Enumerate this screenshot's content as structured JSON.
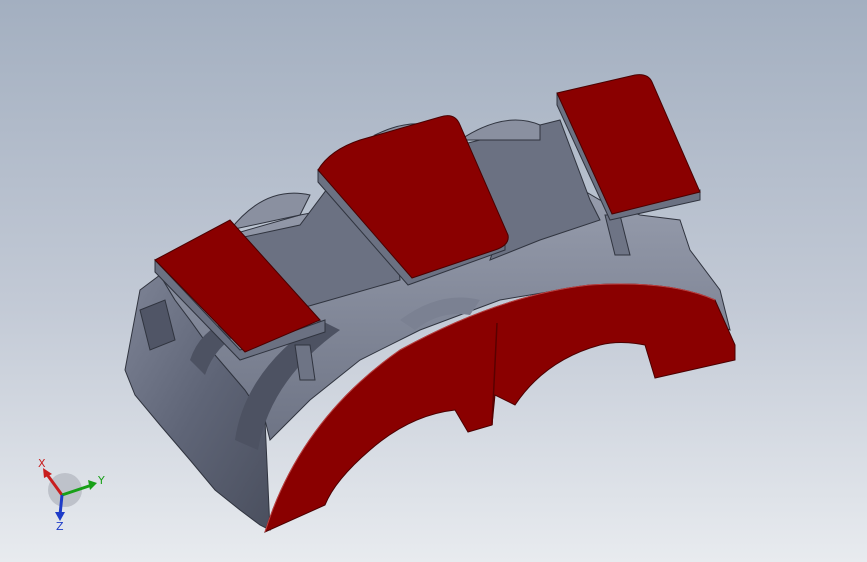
{
  "viewport": {
    "background_top": "#a3afc0",
    "background_bottom": "#e8ebef"
  },
  "model": {
    "body_color": "#5f6577",
    "highlight_color": "#8a90a0",
    "accent_color": "#8a0000",
    "accent_dark": "#6b0000"
  },
  "triad": {
    "x_label": "X",
    "y_label": "Y",
    "z_label": "Z",
    "x_color": "#c81e1e",
    "y_color": "#18a018",
    "z_color": "#1e3cc8",
    "icon": "axis-triad-icon"
  }
}
